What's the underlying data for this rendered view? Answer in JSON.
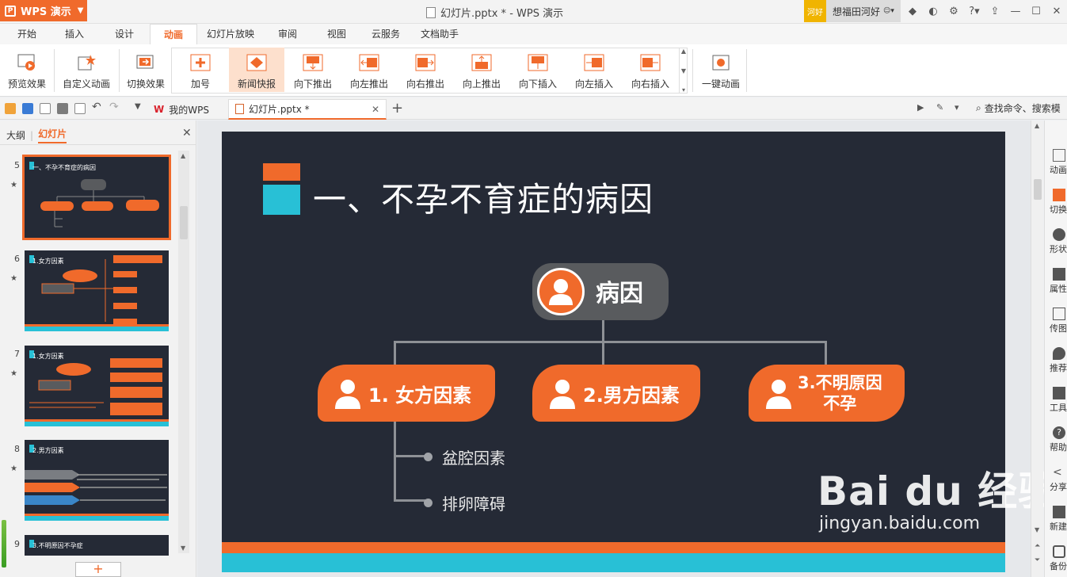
{
  "app": {
    "name": "WPS 演示",
    "doc_title": "幻灯片.pptx * - WPS 演示",
    "user_badge": "河好",
    "user_name": "想福田河好"
  },
  "menu_tabs": [
    "开始",
    "插入",
    "设计",
    "动画",
    "幻灯片放映",
    "审阅",
    "视图",
    "云服务",
    "文档助手"
  ],
  "active_tab": "动画",
  "ribbon": {
    "preview": "预览效果",
    "custom_anim": "自定义动画",
    "switch_effect": "切换效果",
    "gallery": [
      "加号",
      "新闻快报",
      "向下推出",
      "向左推出",
      "向右推出",
      "向上推出",
      "向下插入",
      "向左插入",
      "向右插入"
    ],
    "one_key": "一键动画"
  },
  "doc_tabs": {
    "my_wps": "我的WPS",
    "file": "幻灯片.pptx *"
  },
  "search_cmd": "查找命令、搜索模",
  "left_panel": {
    "tab_outline": "大纲",
    "tab_slides": "幻灯片",
    "thumbs": [
      {
        "num": "5",
        "title": "一、不孕不育症的病因"
      },
      {
        "num": "6",
        "title": "1.女方因素"
      },
      {
        "num": "7",
        "title": "1.女方因素"
      },
      {
        "num": "8",
        "title": "2.男方因素"
      },
      {
        "num": "9",
        "title": "3.不明原因不孕症"
      }
    ]
  },
  "slide": {
    "title": "一、不孕不育症的病因",
    "root": "病因",
    "nodes": [
      "1. 女方因素",
      "2.男方因素",
      "3.不明原因\n不孕"
    ],
    "node3_line1": "3.不明原因",
    "node3_line2": "不孕",
    "leaves": [
      "盆腔因素",
      "排卵障碍"
    ]
  },
  "watermark": {
    "main": "Bai du 经验",
    "sub": "jingyan.baidu.com"
  },
  "right_sidebar": [
    "动画",
    "切换",
    "形状",
    "属性",
    "传图",
    "推荐",
    "工具",
    "帮助",
    "分享",
    "新建",
    "备份"
  ],
  "colors": {
    "accent": "#f06a2b",
    "cyan": "#28c0d6",
    "slide_bg": "#252a36"
  }
}
